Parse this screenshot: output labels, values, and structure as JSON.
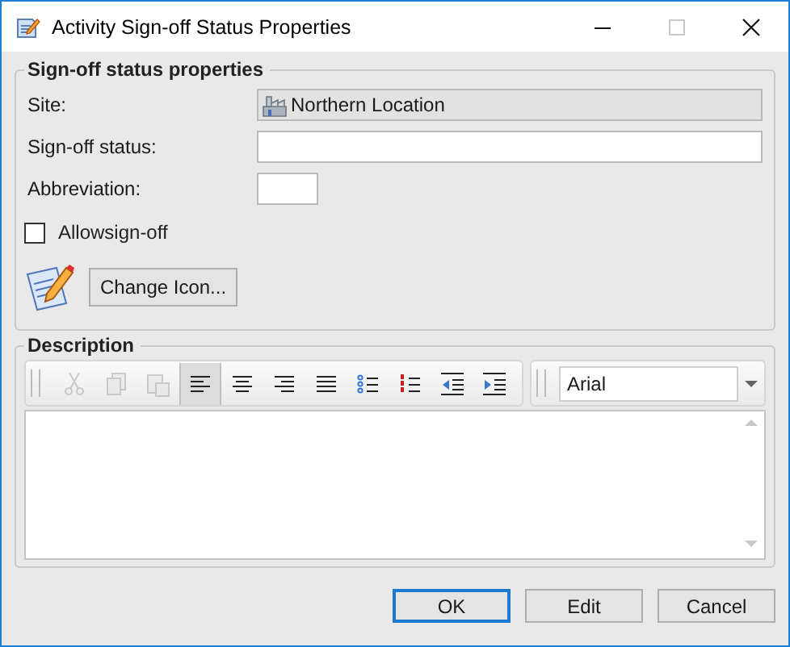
{
  "window": {
    "title": "Activity Sign-off Status Properties"
  },
  "properties": {
    "legend": "Sign-off status properties",
    "site": {
      "label": "Site:",
      "value": "Northern Location"
    },
    "status": {
      "label": "Sign-off status:"
    },
    "abbreviation": {
      "label": "Abbreviation:"
    },
    "allow": {
      "label": "Allowsign-off",
      "checked": false
    },
    "change_icon": "Change Icon..."
  },
  "description": {
    "legend": "Description",
    "toolbar": [
      {
        "kind": "cut",
        "disabled": true,
        "selected": false
      },
      {
        "kind": "copy",
        "disabled": true,
        "selected": false
      },
      {
        "kind": "paste",
        "disabled": true,
        "selected": false
      },
      {
        "kind": "align-left",
        "disabled": false,
        "selected": true
      },
      {
        "kind": "align-center",
        "disabled": false,
        "selected": false
      },
      {
        "kind": "align-right",
        "disabled": false,
        "selected": false
      },
      {
        "kind": "justify",
        "disabled": false,
        "selected": false
      },
      {
        "kind": "bullets",
        "disabled": false,
        "selected": false
      },
      {
        "kind": "numbering",
        "disabled": false,
        "selected": false
      },
      {
        "kind": "outdent",
        "disabled": false,
        "selected": false
      },
      {
        "kind": "indent",
        "disabled": false,
        "selected": false
      }
    ],
    "font": "Arial"
  },
  "buttons": [
    {
      "label": "OK",
      "default": true
    },
    {
      "label": "Edit",
      "default": false
    },
    {
      "label": "Cancel",
      "default": false
    }
  ]
}
